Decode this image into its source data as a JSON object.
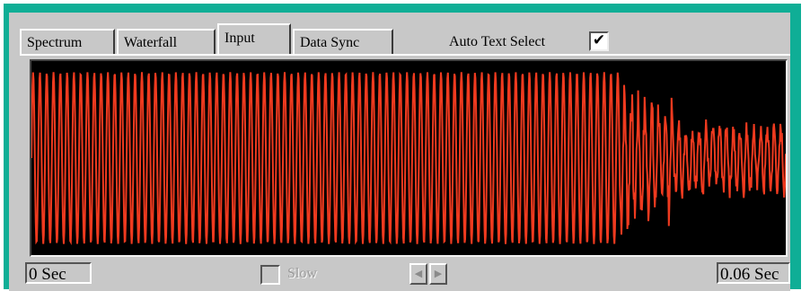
{
  "tabs": [
    {
      "label": "Spectrum",
      "active": false
    },
    {
      "label": "Waterfall",
      "active": false
    },
    {
      "label": "Input",
      "active": true
    },
    {
      "label": "Data Sync",
      "active": false
    }
  ],
  "auto_text_select": {
    "label": "Auto Text Select",
    "checked": true,
    "check_glyph": "✔"
  },
  "scope": {
    "background": "#000000",
    "trace_color": "#ef3a1f"
  },
  "status": {
    "start_time": "0 Sec",
    "end_time": "0.06 Sec",
    "slow_label": "Slow",
    "slow_checked": false,
    "scroll_left_icon": "◀",
    "scroll_right_icon": "▶"
  },
  "colors": {
    "frame": "#0fae96",
    "panel": "#c8c8c8"
  }
}
